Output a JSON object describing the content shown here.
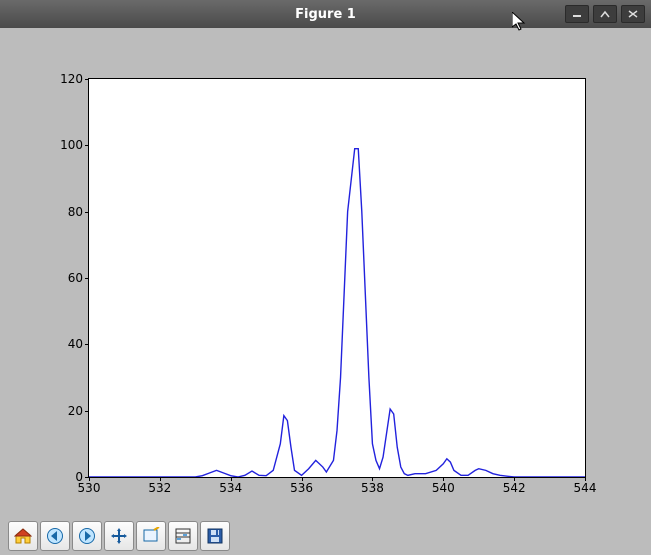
{
  "window": {
    "title": "Figure 1"
  },
  "toolbar": {
    "home": "Home",
    "back": "Back",
    "forward": "Forward",
    "pan": "Pan",
    "zoom": "Zoom",
    "subplots": "Configure subplots",
    "save": "Save"
  },
  "chart_data": {
    "type": "line",
    "title": "",
    "xlabel": "",
    "ylabel": "",
    "xlim": [
      530,
      544
    ],
    "ylim": [
      0,
      120
    ],
    "xticks": [
      530,
      532,
      534,
      536,
      538,
      540,
      542,
      544
    ],
    "yticks": [
      0,
      20,
      40,
      60,
      80,
      100,
      120
    ],
    "series": [
      {
        "name": "",
        "color": "#2222dd",
        "x": [
          530.0,
          530.5,
          531.0,
          531.5,
          532.0,
          532.5,
          533.0,
          533.2,
          533.4,
          533.6,
          533.8,
          534.0,
          534.2,
          534.4,
          534.6,
          534.8,
          535.0,
          535.2,
          535.4,
          535.5,
          535.6,
          535.7,
          535.8,
          536.0,
          536.2,
          536.4,
          536.6,
          536.7,
          536.9,
          537.0,
          537.1,
          537.2,
          537.3,
          537.5,
          537.6,
          537.7,
          537.8,
          537.9,
          538.0,
          538.1,
          538.2,
          538.3,
          538.5,
          538.6,
          538.7,
          538.8,
          538.9,
          539.0,
          539.2,
          539.5,
          539.8,
          540.0,
          540.1,
          540.2,
          540.3,
          540.5,
          540.7,
          540.9,
          541.0,
          541.2,
          541.4,
          541.6,
          542.0,
          542.5,
          543.0,
          543.5,
          544.0
        ],
        "y": [
          0,
          0,
          0,
          0,
          0,
          0,
          0,
          0.4,
          1.2,
          2.0,
          1.2,
          0.4,
          0,
          0.5,
          1.8,
          0.5,
          0.4,
          2.0,
          10,
          18.5,
          17,
          9,
          2,
          0.5,
          2.5,
          5,
          3,
          1.5,
          5,
          14,
          30,
          55,
          80,
          99,
          99,
          80,
          55,
          30,
          10,
          5,
          2.5,
          6,
          20.5,
          19,
          9,
          3,
          1,
          0.5,
          1,
          1,
          2,
          4,
          5.5,
          4.5,
          2,
          0.5,
          0.5,
          2,
          2.5,
          2,
          1,
          0.5,
          0,
          0,
          0,
          0,
          0
        ]
      }
    ]
  }
}
